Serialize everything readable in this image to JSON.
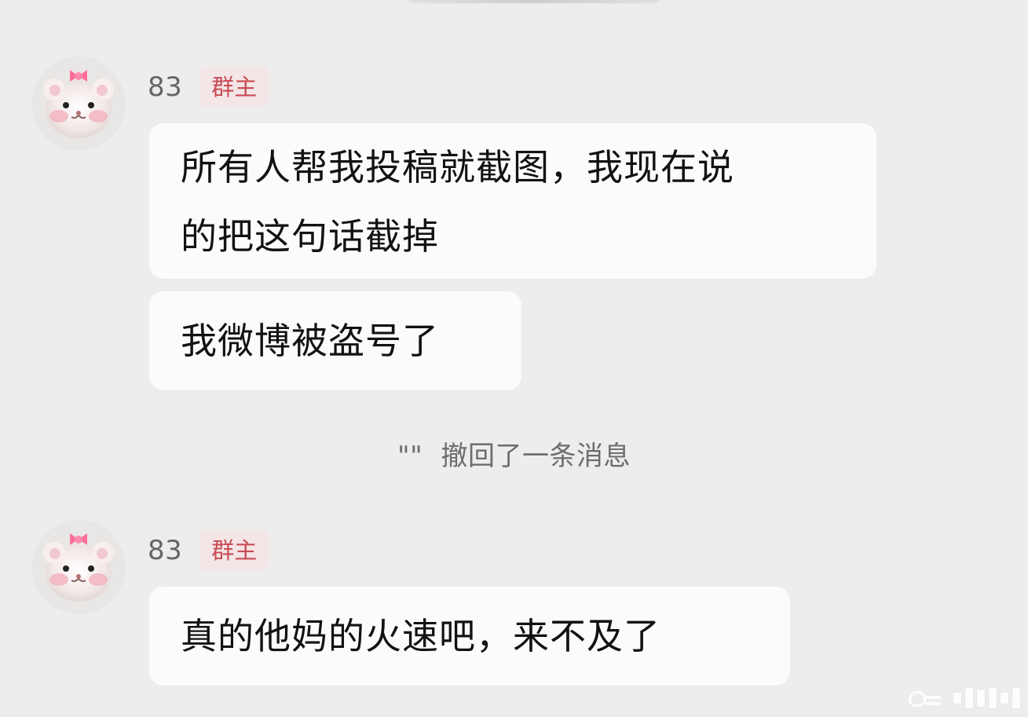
{
  "chat": {
    "messages": [
      {
        "sender": "83",
        "role": "群主",
        "avatar_icon": "hamster-avatar-icon",
        "bubbles": [
          {
            "lines": [
              "所有人帮我投稿就截图，我现在说",
              "的把这句话截掉"
            ]
          },
          {
            "text": "我微博被盗号了"
          }
        ]
      },
      {
        "sender": "83",
        "role": "群主",
        "avatar_icon": "hamster-avatar-icon",
        "bubbles": [
          {
            "text": "真的他妈的火速吧，来不及了"
          }
        ]
      }
    ],
    "recall_notice": {
      "name": "\"\"",
      "text": "撤回了一条消息"
    }
  },
  "colors": {
    "background": "#ededed",
    "bubble": "#fbfbfb",
    "badge_background": "#f4e5e6",
    "badge_text": "#c84b55",
    "secondary_text": "#666666"
  },
  "icons": {
    "avatar": "hamster-avatar-icon",
    "watermark": "weibo-watermark-icon"
  }
}
